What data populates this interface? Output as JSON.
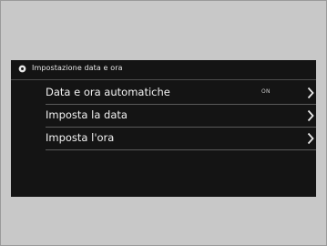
{
  "header": {
    "title": "Impostazione data e ora"
  },
  "menu": {
    "items": [
      {
        "label": "Data e ora automatiche",
        "value": "ON",
        "chevron_icon": "chevron-right-icon"
      },
      {
        "label": "Imposta la data",
        "chevron_icon": "chevron-right-icon"
      },
      {
        "label": "Imposta l'ora",
        "chevron_icon": "chevron-right-icon"
      }
    ]
  },
  "icons": {
    "header": "gear-icon"
  },
  "colors": {
    "frame_background": "#c8c8c8",
    "screen_background": "#141414",
    "text": "#f2f2f2",
    "divider": "#5a5a5a"
  }
}
